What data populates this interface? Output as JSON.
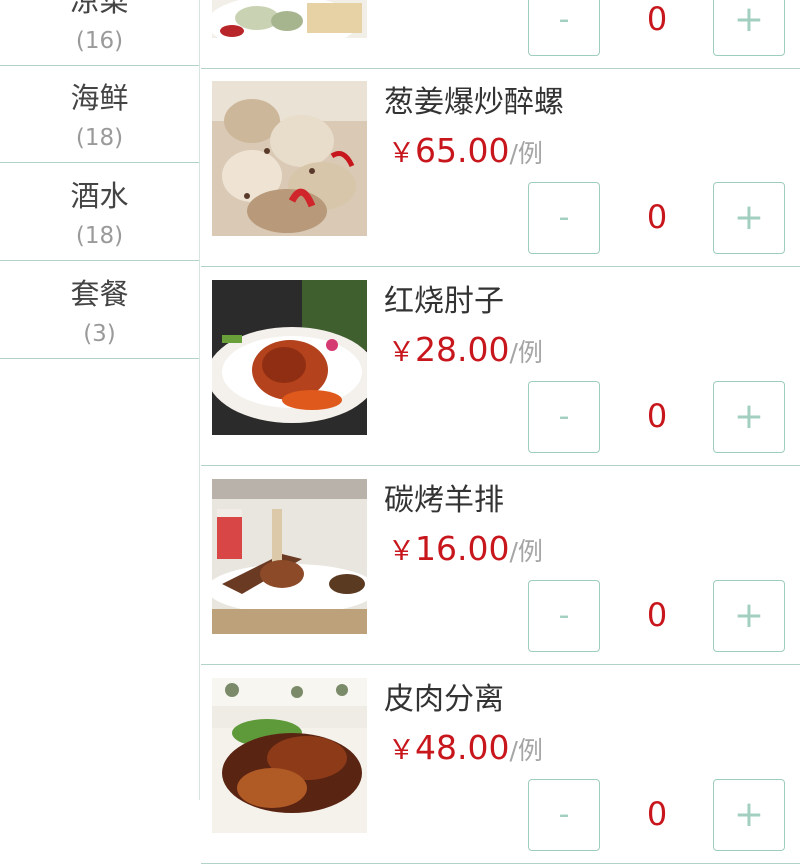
{
  "categories": [
    {
      "name": "凉菜",
      "count": "(16)"
    },
    {
      "name": "海鲜",
      "count": "(18)"
    },
    {
      "name": "酒水",
      "count": "(18)"
    },
    {
      "name": "套餐",
      "count": "(3)"
    }
  ],
  "currency_symbol": "￥",
  "unit_label": "/例",
  "minus_label": "-",
  "plus_label": "+",
  "dishes": [
    {
      "name": "",
      "price": "",
      "qty": "0"
    },
    {
      "name": "葱姜爆炒醉螺",
      "price": "65.00",
      "qty": "0"
    },
    {
      "name": "红烧肘子",
      "price": "28.00",
      "qty": "0"
    },
    {
      "name": "碳烤羊排",
      "price": "16.00",
      "qty": "0"
    },
    {
      "name": "皮肉分离",
      "price": "48.00",
      "qty": "0"
    }
  ],
  "colors": {
    "accent_price": "#c8161d",
    "button_border": "#9fcdbd",
    "divider": "#b3d3c8"
  }
}
